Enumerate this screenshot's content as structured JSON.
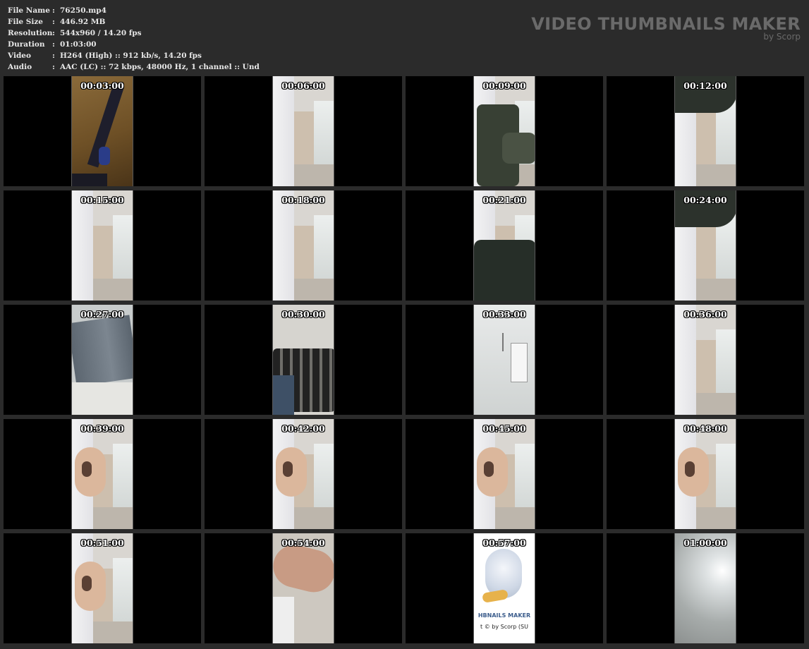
{
  "info": {
    "file_name": {
      "label": "File Name",
      "sep": ":",
      "value": "76250.mp4"
    },
    "file_size": {
      "label": "File Size",
      "sep": ":",
      "value": "446.92 MB"
    },
    "resolution": {
      "label": "Resolution",
      "sep": ":",
      "value": "544x960 / 14.20 fps"
    },
    "duration": {
      "label": "Duration",
      "sep": ":",
      "value": "01:03:00"
    },
    "video": {
      "label": "Video",
      "sep": ":",
      "value": "H264 (High) :: 912 kb/s, 14.20 fps"
    },
    "audio": {
      "label": "Audio",
      "sep": ":",
      "value": "AAC (LC) :: 72 kbps, 48000 Hz, 1 channel :: Und"
    }
  },
  "brand": {
    "title": "VIDEO THUMBNAILS MAKER",
    "subtitle": "by Scorp"
  },
  "thumbnails": [
    {
      "time": "00:03:00",
      "scene": "floor"
    },
    {
      "time": "00:06:00",
      "scene": "room"
    },
    {
      "time": "00:09:00",
      "scene": "jacket-top"
    },
    {
      "time": "00:12:00",
      "scene": "room-dark-top"
    },
    {
      "time": "00:15:00",
      "scene": "room"
    },
    {
      "time": "00:18:00",
      "scene": "room"
    },
    {
      "time": "00:21:00",
      "scene": "jacket-bottom"
    },
    {
      "time": "00:24:00",
      "scene": "room-dark-top"
    },
    {
      "time": "00:27:00",
      "scene": "jeans"
    },
    {
      "time": "00:30:00",
      "scene": "bag"
    },
    {
      "time": "00:33:00",
      "scene": "ac-unit"
    },
    {
      "time": "00:36:00",
      "scene": "room"
    },
    {
      "time": "00:39:00",
      "scene": "room-figure"
    },
    {
      "time": "00:42:00",
      "scene": "room-figure"
    },
    {
      "time": "00:45:00",
      "scene": "room-figure"
    },
    {
      "time": "00:48:00",
      "scene": "room-figure"
    },
    {
      "time": "00:51:00",
      "scene": "room-figure"
    },
    {
      "time": "00:54:00",
      "scene": "arm"
    },
    {
      "time": "00:57:00",
      "scene": "logo",
      "logo_text": "HBNAILS MAKER",
      "logo_copyright": "t © by Scorp (SU"
    },
    {
      "time": "01:00:00",
      "scene": "ceiling-light"
    }
  ]
}
